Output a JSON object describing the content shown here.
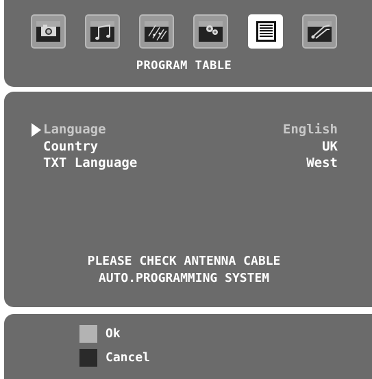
{
  "menu": {
    "tabs": [
      {
        "icon": "camera-icon",
        "active": false
      },
      {
        "icon": "music-note-icon",
        "active": false
      },
      {
        "icon": "features-icon",
        "active": false
      },
      {
        "icon": "install-icon",
        "active": false
      },
      {
        "icon": "program-table-icon",
        "active": true
      },
      {
        "icon": "source-icon",
        "active": false
      }
    ],
    "title": "PROGRAM TABLE"
  },
  "settings": [
    {
      "label": "Language",
      "value": "English",
      "selected": true
    },
    {
      "label": "Country",
      "value": "UK",
      "selected": false
    },
    {
      "label": "TXT Language",
      "value": "West",
      "selected": false
    }
  ],
  "message": {
    "line1": "PLEASE CHECK ANTENNA CABLE",
    "line2": "AUTO.PROGRAMMING SYSTEM"
  },
  "footer": {
    "ok_label": "Ok",
    "cancel_label": "Cancel",
    "ok_color": "#b3b3b3",
    "cancel_color": "#2a2a2a"
  }
}
